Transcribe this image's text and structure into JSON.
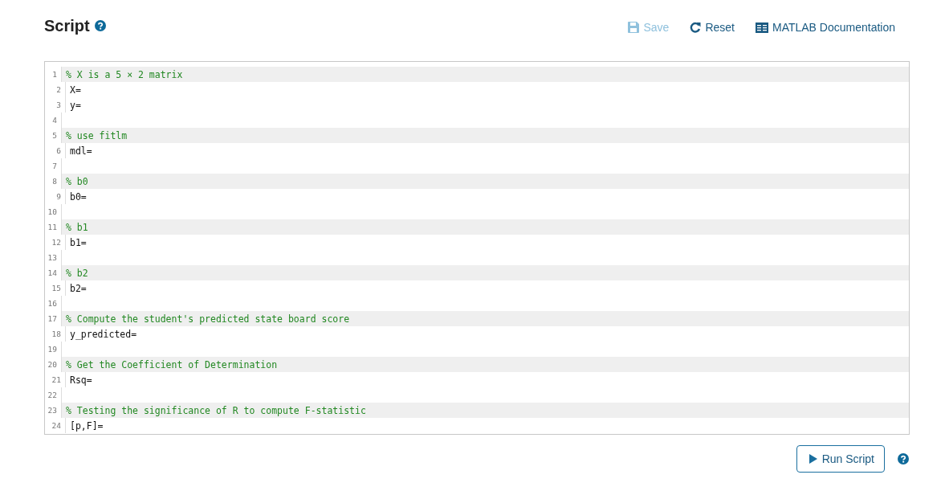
{
  "header": {
    "title": "Script",
    "actions": [
      {
        "label": "Save",
        "kind": "save",
        "disabled": true
      },
      {
        "label": "Reset",
        "kind": "reset",
        "disabled": false
      },
      {
        "label": "MATLAB Documentation",
        "kind": "docs",
        "disabled": false
      }
    ]
  },
  "editor": {
    "lines": [
      {
        "number": "1",
        "kind": "comment",
        "text": "% X is a 5 × 2 matrix"
      },
      {
        "number": "2",
        "kind": "code",
        "text": "X="
      },
      {
        "number": "3",
        "kind": "code",
        "text": "y="
      },
      {
        "number": "4",
        "kind": "blank"
      },
      {
        "number": "5",
        "kind": "comment",
        "text": "% use fitlm"
      },
      {
        "number": "6",
        "kind": "code",
        "text": "mdl="
      },
      {
        "number": "7",
        "kind": "blank"
      },
      {
        "number": "8",
        "kind": "comment",
        "text": "% b0"
      },
      {
        "number": "9",
        "kind": "code",
        "text": "b0="
      },
      {
        "number": "10",
        "kind": "blank"
      },
      {
        "number": "11",
        "kind": "comment",
        "text": "% b1"
      },
      {
        "number": "12",
        "kind": "code",
        "text": "b1="
      },
      {
        "number": "13",
        "kind": "blank"
      },
      {
        "number": "14",
        "kind": "comment",
        "text": "% b2"
      },
      {
        "number": "15",
        "kind": "code",
        "text": "b2="
      },
      {
        "number": "16",
        "kind": "blank"
      },
      {
        "number": "17",
        "kind": "comment",
        "text": "% Compute the student's predicted state board score"
      },
      {
        "number": "18",
        "kind": "code",
        "text": "y_predicted="
      },
      {
        "number": "19",
        "kind": "blank"
      },
      {
        "number": "20",
        "kind": "comment",
        "text": "% Get the Coefficient of Determination"
      },
      {
        "number": "21",
        "kind": "code",
        "text": "Rsq="
      },
      {
        "number": "22",
        "kind": "blank"
      },
      {
        "number": "23",
        "kind": "comment",
        "text": "% Testing the significance of R to compute F-statistic"
      },
      {
        "number": "24",
        "kind": "code",
        "text": "[p,F]="
      }
    ]
  },
  "footer": {
    "run_button": "Run Script"
  }
}
